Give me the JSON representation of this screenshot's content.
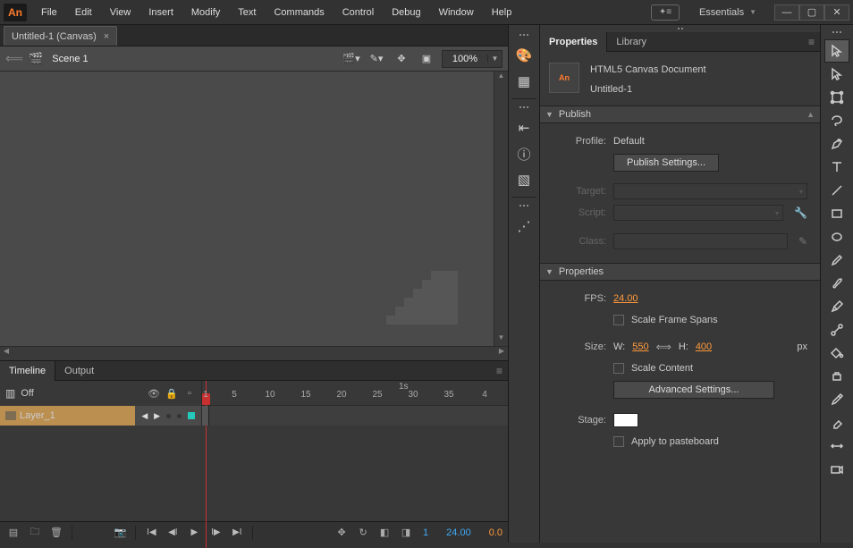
{
  "app_label": "An",
  "menu": [
    "File",
    "Edit",
    "View",
    "Insert",
    "Modify",
    "Text",
    "Commands",
    "Control",
    "Debug",
    "Window",
    "Help"
  ],
  "workspace": "Essentials",
  "doc_tab": "Untitled-1 (Canvas)",
  "scene": "Scene 1",
  "zoom": "100%",
  "timeline": {
    "tabs": [
      "Timeline",
      "Output"
    ],
    "off": "Off",
    "layer": "Layer_1",
    "ticks": [
      1,
      5,
      10,
      15,
      20,
      25,
      30,
      35,
      4
    ],
    "second_marker": "1s",
    "frame": "1",
    "fps": "24.00",
    "time": "0.0"
  },
  "properties": {
    "tabs": [
      "Properties",
      "Library"
    ],
    "doc_type": "HTML5 Canvas Document",
    "doc_name": "Untitled-1",
    "sections": {
      "publish": "Publish",
      "props": "Properties"
    },
    "profile_label": "Profile:",
    "profile_value": "Default",
    "publish_settings_btn": "Publish Settings...",
    "target_label": "Target:",
    "script_label": "Script:",
    "class_label": "Class:",
    "fps_label": "FPS:",
    "fps_value": "24.00",
    "scale_frame_spans": "Scale Frame Spans",
    "size_label": "Size:",
    "w_label": "W:",
    "w_value": "550",
    "h_label": "H:",
    "h_value": "400",
    "px": "px",
    "scale_content": "Scale Content",
    "advanced_btn": "Advanced Settings...",
    "stage_label": "Stage:",
    "apply_pb": "Apply to pasteboard"
  }
}
